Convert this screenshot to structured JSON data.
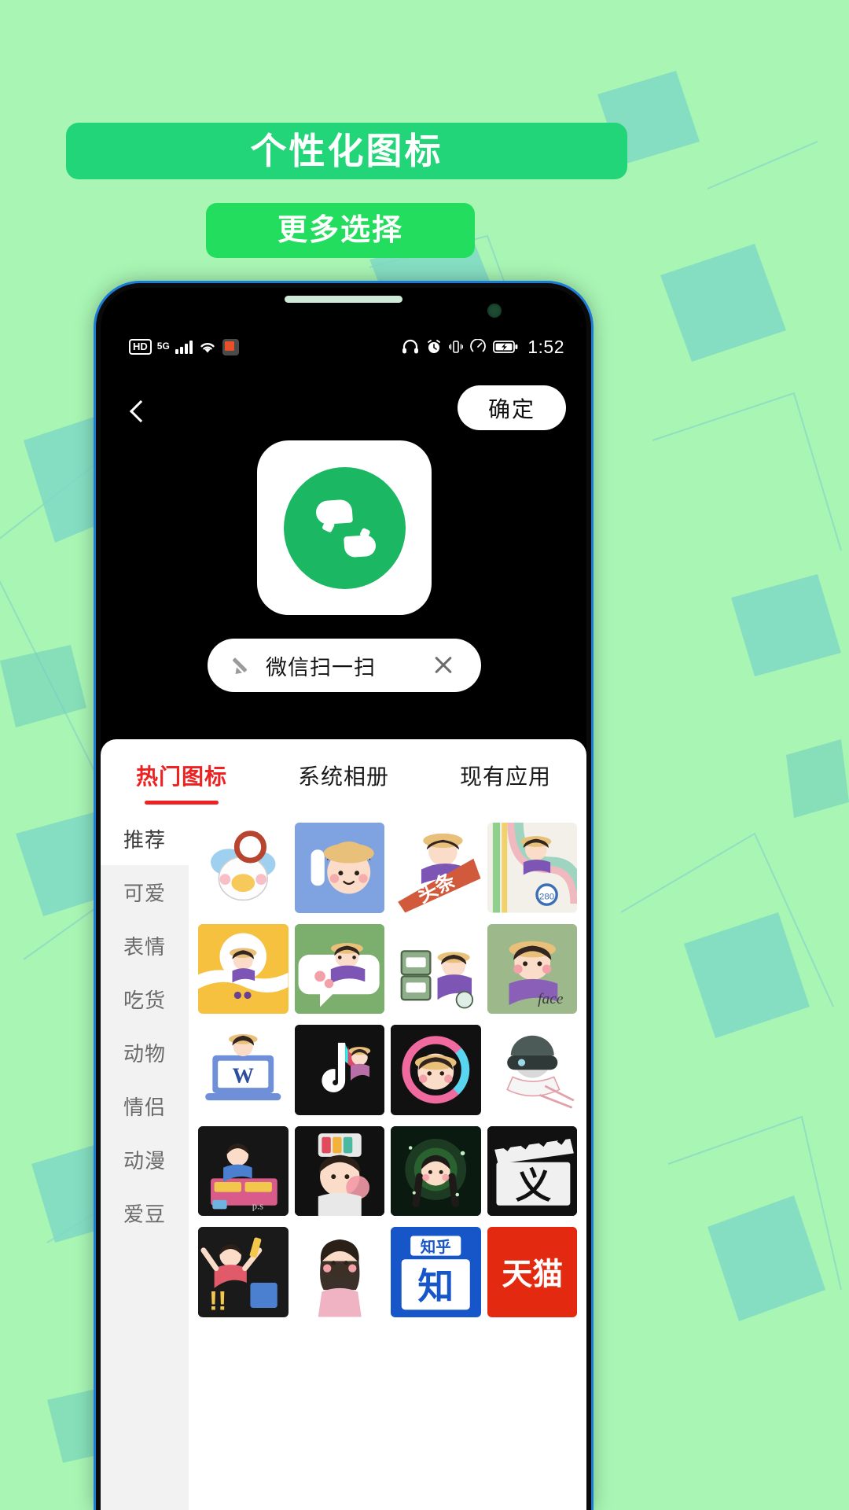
{
  "promo": {
    "title": "个性化图标",
    "subtitle": "更多选择",
    "title_bg": "#22d578",
    "subtitle_bg": "#22dd5e",
    "page_bg": "#a8f5b4"
  },
  "status_bar": {
    "hd_label": "HD",
    "network_label": "5G",
    "time": "1:52",
    "icons": [
      "hd-badge",
      "5g-label",
      "signal-bars-icon",
      "wifi-icon",
      "app-notification-icon",
      "headphones-icon",
      "alarm-clock-icon",
      "vibrate-icon",
      "data-saver-icon",
      "battery-charging-icon"
    ]
  },
  "nav": {
    "back_icon": "chevron-left-icon",
    "confirm_label": "确定"
  },
  "preview": {
    "icon_name": "wechat-scan-icon",
    "accent": "#1bb763"
  },
  "name_field": {
    "value": "微信扫一扫",
    "edit_icon": "pencil-icon",
    "clear_icon": "close-icon"
  },
  "picker": {
    "tabs": [
      {
        "label": "热门图标",
        "active": true
      },
      {
        "label": "系统相册",
        "active": false
      },
      {
        "label": "现有应用",
        "active": false
      }
    ],
    "active_tab_color": "#ee2222",
    "categories": [
      {
        "label": "推荐",
        "active": true
      },
      {
        "label": "可爱",
        "active": false
      },
      {
        "label": "表情",
        "active": false
      },
      {
        "label": "吃货",
        "active": false
      },
      {
        "label": "动物",
        "active": false
      },
      {
        "label": "情侣",
        "active": false
      },
      {
        "label": "动漫",
        "active": false
      },
      {
        "label": "爱豆",
        "active": false
      }
    ],
    "icons": [
      {
        "name": "duck-hat-icon",
        "bg": "#ffffff",
        "style": "duck"
      },
      {
        "name": "girl-phone-blue-icon",
        "bg": "#7fa3e0",
        "style": "girlphone"
      },
      {
        "name": "toutiao-banner-icon",
        "bg": "#ffffff",
        "style": "toutiao"
      },
      {
        "name": "map-road-icon",
        "bg": "#ffffff",
        "style": "map"
      },
      {
        "name": "girl-sun-yellow-icon",
        "bg": "#f5c13f",
        "style": "sun"
      },
      {
        "name": "girl-bubble-green-icon",
        "bg": "#7cae6e",
        "style": "bubble"
      },
      {
        "name": "girl-vending-icon",
        "bg": "#ffffff",
        "style": "vending"
      },
      {
        "name": "girl-racoon-icon",
        "bg": "#9db98c",
        "style": "racoon"
      },
      {
        "name": "laptop-word-icon",
        "bg": "#ffffff",
        "style": "laptop"
      },
      {
        "name": "tiktok-note-icon",
        "bg": "#111111",
        "style": "tiktok"
      },
      {
        "name": "girl-pink-ring-icon",
        "bg": "#111111",
        "style": "ring"
      },
      {
        "name": "vr-helmet-icon",
        "bg": "#ffffff",
        "style": "vr"
      },
      {
        "name": "girl-desk-dark-icon",
        "bg": "#161616",
        "style": "desk"
      },
      {
        "name": "girl-camera-icon",
        "bg": "#111111",
        "style": "camera"
      },
      {
        "name": "girl-glow-green-icon",
        "bg": "#0b1a10",
        "style": "glow"
      },
      {
        "name": "clapboard-icon",
        "bg": "#111111",
        "style": "clap"
      },
      {
        "name": "girl-celebrate-icon",
        "bg": "#1a1a1a",
        "style": "celebrate"
      },
      {
        "name": "girl-pink-phone-icon",
        "bg": "#ffffff",
        "style": "pinkphone"
      },
      {
        "name": "blue-sign-icon",
        "bg": "#1756c8",
        "style": "bluesign"
      },
      {
        "name": "tmall-icon",
        "bg": "#e32a10",
        "style": "tmall"
      }
    ]
  }
}
